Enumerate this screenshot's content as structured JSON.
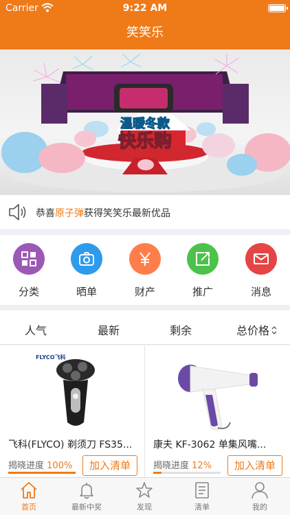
{
  "status_bar": {
    "carrier": "Carrier",
    "time": "9:22 AM"
  },
  "nav": {
    "title": "笑笑乐"
  },
  "banner": {
    "line1": "温暖冬款",
    "line2": "快乐购"
  },
  "notice": {
    "prefix": "恭喜",
    "user": "原子弹",
    "suffix": "获得笑笑乐最新优品"
  },
  "categories": [
    {
      "label": "分类",
      "icon": "grid-icon",
      "color": "#9b59b6"
    },
    {
      "label": "晒单",
      "icon": "camera-icon",
      "color": "#2e9bec"
    },
    {
      "label": "财产",
      "icon": "yen-icon",
      "color": "#ff7d4a"
    },
    {
      "label": "推广",
      "icon": "share-icon",
      "color": "#4cc24a"
    },
    {
      "label": "消息",
      "icon": "mail-icon",
      "color": "#e64545"
    }
  ],
  "sort_options": [
    "人气",
    "最新",
    "剩余",
    "总价格"
  ],
  "products": [
    {
      "brand": "FLYCO飞科",
      "title": "飞科(FLYCO) 剃须刀 FS35...",
      "progress_label": "揭晓进度",
      "progress_text": "100%",
      "progress": 1.0,
      "add_label": "加入清单"
    },
    {
      "brand": "",
      "title": "康夫 KF-3062 单集风嘴...",
      "progress_label": "揭晓进度",
      "progress_text": "12%",
      "progress": 0.12,
      "add_label": "加入清单"
    }
  ],
  "tabs": [
    {
      "label": "首页",
      "icon": "home-icon",
      "active": true
    },
    {
      "label": "最新中奖",
      "icon": "bell-icon",
      "active": false
    },
    {
      "label": "发现",
      "icon": "star-icon",
      "active": false
    },
    {
      "label": "清单",
      "icon": "list-icon",
      "active": false
    },
    {
      "label": "我的",
      "icon": "user-icon",
      "active": false
    }
  ],
  "colors": {
    "accent": "#ef7a18",
    "background": "#efeff4"
  }
}
